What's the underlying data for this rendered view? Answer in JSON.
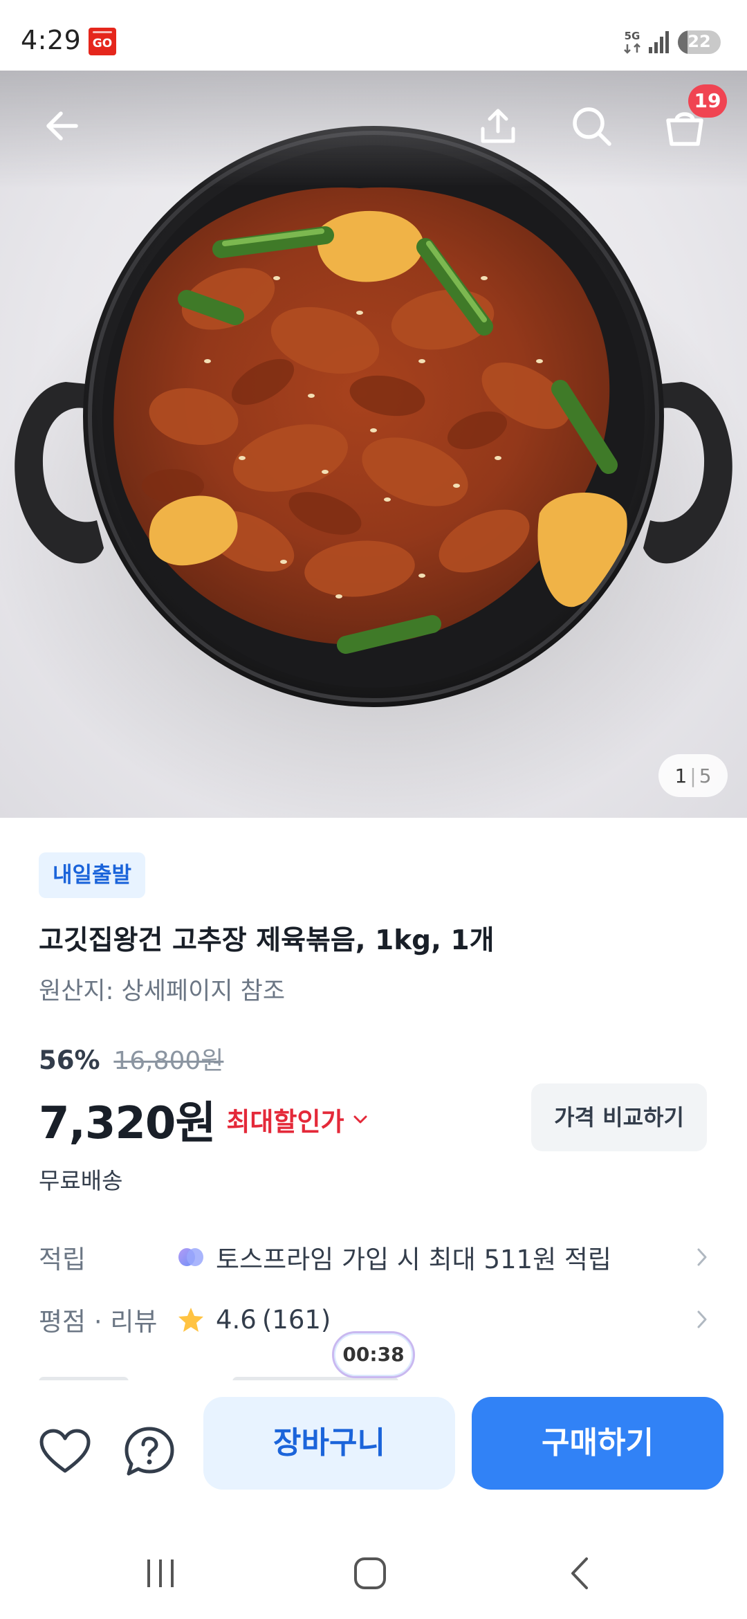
{
  "status_bar": {
    "time": "4:29",
    "app_badge": "GO",
    "network": "5G",
    "battery": "22",
    "battery_level_percent": 22
  },
  "hero": {
    "image_alt": "dish-photo",
    "image_counter": {
      "current": "1",
      "separator": "|",
      "total": "5"
    },
    "cart_count": "19"
  },
  "product": {
    "delivery_badge": "내일출발",
    "title": "고깃집왕건 고추장 제육볶음, 1kg, 1개",
    "origin": "원산지: 상세페이지 참조",
    "discount_rate": "56%",
    "original_price": "16,800원",
    "sale_price": "7,320원",
    "max_discount_label": "최대할인가",
    "compare_button": "가격 비교하기",
    "shipping": "무료배송"
  },
  "info_rows": {
    "points_label": "적립",
    "points_value": "토스프라임 가입 시 최대 511원 적립",
    "rating_label": "평점 · 리뷰",
    "rating_score": "4.6",
    "rating_count": "(161)"
  },
  "timer": "00:38",
  "action_bar": {
    "cart_button": "장바구니",
    "buy_button": "구매하기"
  },
  "colors": {
    "primary": "#3182f6",
    "primary_light": "#e8f3ff",
    "discount_red": "#e42939",
    "badge_red": "#f04452",
    "star": "#ffc342"
  }
}
